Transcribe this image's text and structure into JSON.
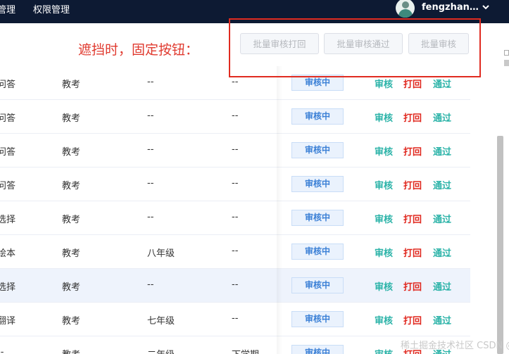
{
  "nav": {
    "items": [
      "管理",
      "权限管理"
    ],
    "username": "fengzhan…"
  },
  "toolbar": {
    "hint": "遮挡时，固定按钮：",
    "buttons": [
      "批量审核打回",
      "批量审核通过",
      "批量审核"
    ]
  },
  "table": {
    "rows": [
      {
        "c0": "问答",
        "c1": "教考",
        "c2": "--",
        "c3": "--",
        "status": "审核中"
      },
      {
        "c0": "问答",
        "c1": "教考",
        "c2": "--",
        "c3": "--",
        "status": "审核中"
      },
      {
        "c0": "问答",
        "c1": "教考",
        "c2": "--",
        "c3": "--",
        "status": "审核中"
      },
      {
        "c0": "问答",
        "c1": "教考",
        "c2": "--",
        "c3": "--",
        "status": "审核中"
      },
      {
        "c0": "选择",
        "c1": "教考",
        "c2": "--",
        "c3": "--",
        "status": "审核中"
      },
      {
        "c0": "绘本",
        "c1": "教考",
        "c2": "八年级",
        "c3": "--",
        "status": "审核中"
      },
      {
        "c0": "选择",
        "c1": "教考",
        "c2": "--",
        "c3": "--",
        "status": "审核中"
      },
      {
        "c0": "翻译",
        "c1": "教考",
        "c2": "七年级",
        "c3": "--",
        "status": "审核中"
      },
      {
        "c0": "--",
        "c1": "教考",
        "c2": "二年级",
        "c3": "下学期",
        "status": "审核中"
      }
    ],
    "actions": {
      "review": "审核",
      "reject": "打回",
      "approve": "通过"
    }
  },
  "watermark": "稀土掘金技术社区 CSDN @搬砖"
}
